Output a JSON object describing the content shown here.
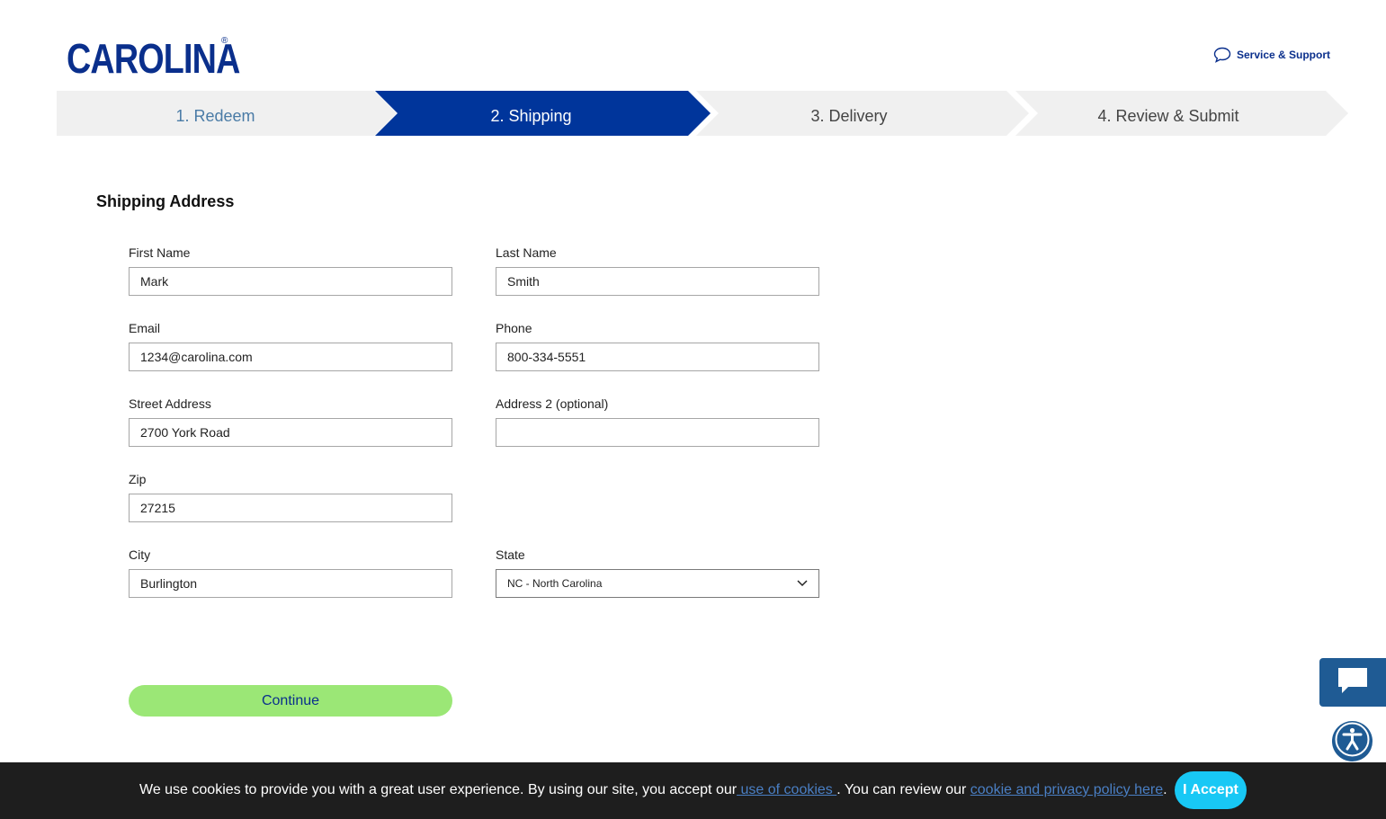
{
  "header": {
    "logo_text": "CAROLINA",
    "logo_reg": "®",
    "service_link": "Service & Support"
  },
  "steps": [
    {
      "label": "1. Redeem",
      "state": "completed"
    },
    {
      "label": "2. Shipping",
      "state": "active"
    },
    {
      "label": "3. Delivery",
      "state": "upcoming"
    },
    {
      "label": "4. Review & Submit",
      "state": "upcoming"
    }
  ],
  "form": {
    "title": "Shipping Address",
    "first_name": {
      "label": "First Name",
      "value": "Mark"
    },
    "last_name": {
      "label": "Last Name",
      "value": "Smith"
    },
    "email": {
      "label": "Email",
      "value": "1234@carolina.com"
    },
    "phone": {
      "label": "Phone",
      "value": "800-334-5551"
    },
    "street": {
      "label": "Street Address",
      "value": "2700 York Road"
    },
    "address2": {
      "label": "Address 2 (optional)",
      "value": ""
    },
    "zip": {
      "label": "Zip",
      "value": "27215"
    },
    "city": {
      "label": "City",
      "value": "Burlington"
    },
    "state": {
      "label": "State",
      "value": "NC - North Carolina"
    },
    "continue_label": "Continue"
  },
  "cookie": {
    "text_1": "We use cookies to provide you with a great user experience. By using our site, you accept our",
    "link_1": " use of cookies ",
    "text_2": ". You can review our ",
    "link_2": "cookie and privacy policy here",
    "text_3": ".",
    "accept_label": "I Accept"
  },
  "colors": {
    "brand_blue": "#0a2f8c",
    "step_active": "#00359b",
    "step_inactive": "#f0f0f0",
    "continue_green": "#9be776",
    "accept_cyan": "#18c8f5",
    "widget_blue": "#1f5b94",
    "cookie_bg": "#1e1e1e"
  }
}
